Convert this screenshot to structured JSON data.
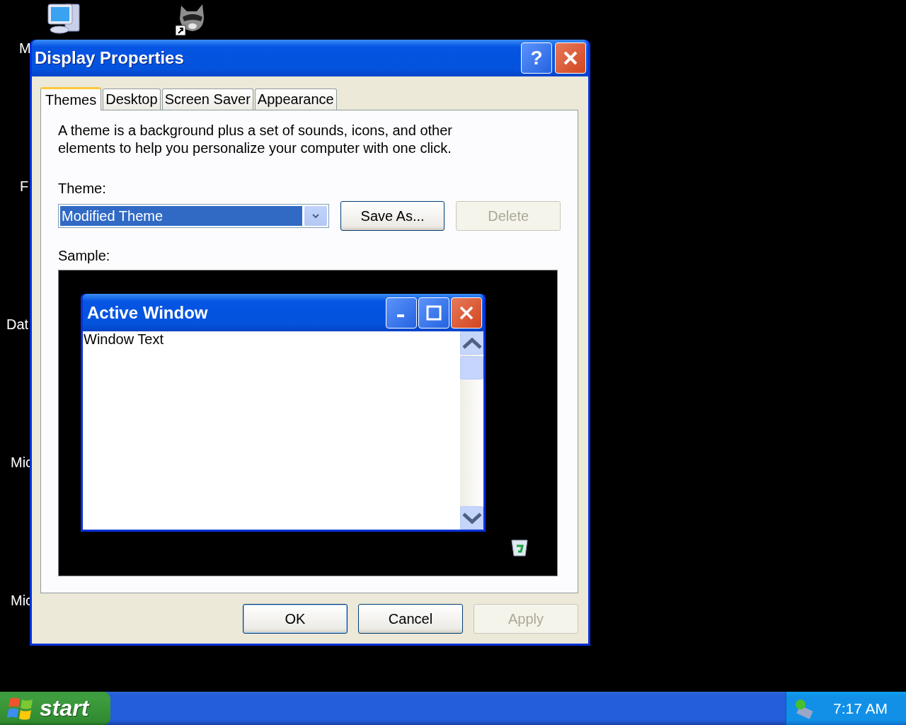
{
  "desktop": {
    "labels": [
      "M",
      "F",
      "Dat",
      "Mic",
      "Mic"
    ]
  },
  "dialog": {
    "title": "Display Properties",
    "help_button": "?",
    "tabs": [
      {
        "label": "Themes",
        "selected": true
      },
      {
        "label": "Desktop",
        "selected": false
      },
      {
        "label": "Screen Saver",
        "selected": false
      },
      {
        "label": "Appearance",
        "selected": false
      }
    ],
    "description": "A theme is a background plus a set of sounds, icons, and other elements to help you personalize your computer with one click.",
    "theme_label": "Theme:",
    "theme_select": {
      "value": "Modified Theme"
    },
    "theme_buttons": [
      {
        "label": "Save As...",
        "disabled": false
      },
      {
        "label": "Delete",
        "disabled": true
      }
    ],
    "sample_label": "Sample:",
    "sample": {
      "window_title": "Active Window",
      "window_text": "Window Text"
    },
    "buttons": [
      {
        "label": "OK",
        "disabled": false
      },
      {
        "label": "Cancel",
        "disabled": false
      },
      {
        "label": "Apply",
        "disabled": true
      }
    ]
  },
  "taskbar": {
    "start": "start",
    "clock": "7:17 AM"
  }
}
